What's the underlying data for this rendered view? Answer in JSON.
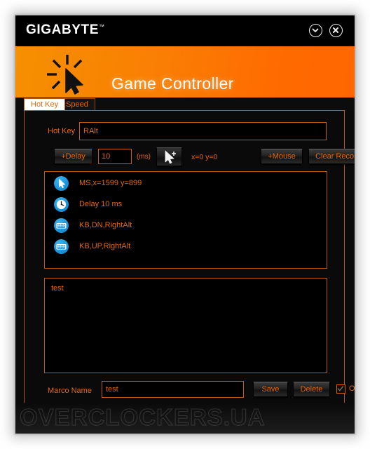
{
  "window": {
    "brand": "GIGABYTE",
    "brand_tm": "™",
    "banner_title": "Game Controller",
    "minimize_icon": "chevron-down-circle-icon",
    "close_icon": "close-circle-icon",
    "banner_icon": "click-cursor-icon"
  },
  "tabs": [
    {
      "label": "Hot Key",
      "active": true
    },
    {
      "label": "Speed",
      "active": false
    }
  ],
  "hotkey": {
    "label": "Hot Key",
    "value": "RAlt",
    "placeholder": ""
  },
  "toolbar": {
    "delay_label": "+Delay",
    "delay_value": "10",
    "delay_placeholder": "",
    "ms_label": "(ms)",
    "cursor_icon": "cursor-add-icon",
    "coords_label": "x=0 y=0",
    "mouse_label": "+Mouse",
    "clear_label": "Clear Record"
  },
  "records": [
    {
      "icon": "mouse-cursor-icon",
      "label": "MS,x=1599  y=899"
    },
    {
      "icon": "clock-icon",
      "label": "Delay 10 ms"
    },
    {
      "icon": "keyboard-icon",
      "label": "KB,DN,RightAlt"
    },
    {
      "icon": "keyboard-icon",
      "label": "KB,UP,RightAlt"
    }
  ],
  "macro_panel": {
    "text": "test"
  },
  "bottom": {
    "marco_label": "Marco Name",
    "marco_value": "test",
    "marco_placeholder": "",
    "save_label": "Save",
    "delete_label": "Delete",
    "on_label": "ON",
    "on_checked": true
  },
  "footer": {
    "watermark": "OVERCLOCKERS.UA"
  },
  "colors": {
    "accent_orange": "#e0690f",
    "border_orange": "#b45a11",
    "banner_left": "#f59000",
    "banner_right": "#ff6600",
    "icon_blue": "#1c96dd",
    "panel_black": "#000000"
  }
}
